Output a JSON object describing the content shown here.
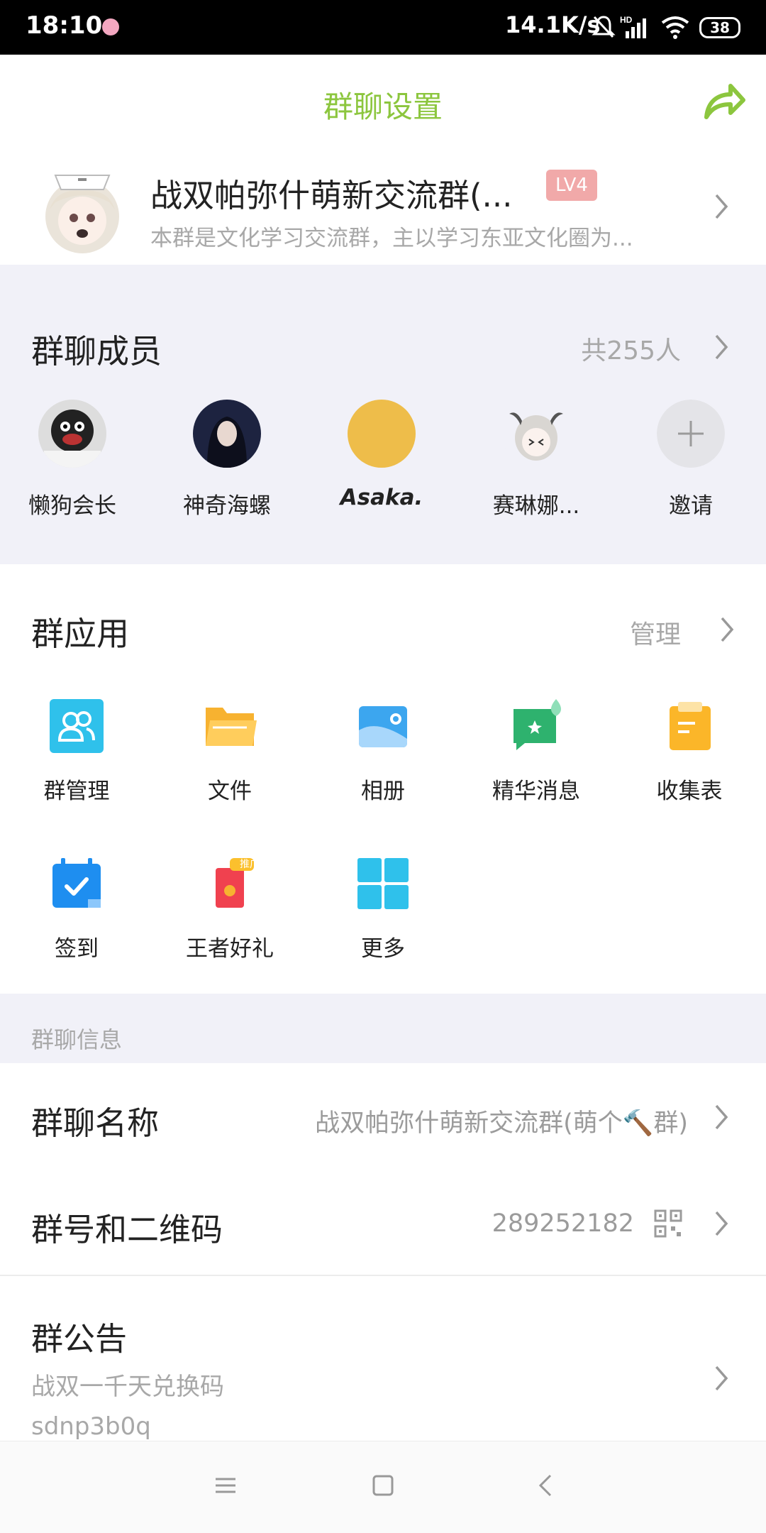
{
  "status_bar": {
    "time": "18:10",
    "speed": "14.1K/s",
    "battery": "38"
  },
  "header": {
    "title": "群聊设置",
    "share_icon": "share-icon",
    "accent_color": "#8cc63e"
  },
  "group": {
    "name": "战双帕弥什萌新交流群(...",
    "level_badge": "LV4",
    "description": "本群是文化学习交流群，主以学习东亚文化圈为..."
  },
  "members": {
    "title": "群聊成员",
    "count": "共255人",
    "list": [
      {
        "name": "懒狗会长"
      },
      {
        "name": "神奇海螺"
      },
      {
        "name": "Asaka."
      },
      {
        "name": "赛琳娜..."
      },
      {
        "name": "邀请"
      }
    ]
  },
  "apps": {
    "title": "群应用",
    "manage_label": "管理",
    "items": [
      {
        "label": "群管理",
        "icon": "group-manage-icon"
      },
      {
        "label": "文件",
        "icon": "folder-icon"
      },
      {
        "label": "相册",
        "icon": "album-icon"
      },
      {
        "label": "精华消息",
        "icon": "essence-message-icon"
      },
      {
        "label": "收集表",
        "icon": "collection-form-icon"
      },
      {
        "label": "签到",
        "icon": "check-in-icon"
      },
      {
        "label": "王者好礼",
        "icon": "gift-icon",
        "tag": "推广"
      },
      {
        "label": "更多",
        "icon": "more-grid-icon"
      }
    ]
  },
  "info": {
    "section_title": "群聊信息",
    "name_label": "群聊名称",
    "name_value": "战双帕弥什萌新交流群(萌个🔨群)",
    "number_label": "群号和二维码",
    "number_value": "289252182",
    "notice_label": "群公告",
    "notice_line1": "战双一千天兑换码",
    "notice_line2": "sdnp3b0q"
  }
}
